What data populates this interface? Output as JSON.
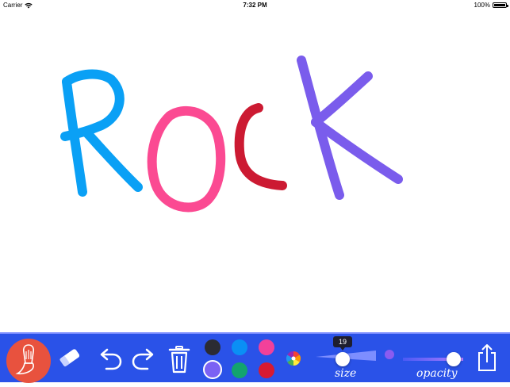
{
  "status_bar": {
    "carrier": "Carrier",
    "time": "7:32 PM",
    "battery": "100%"
  },
  "canvas": {
    "drawing_text": "ROCK",
    "colors": {
      "R": "#0aa0f5",
      "O": "#fb4a92",
      "C": "#cc1a32",
      "K": "#7a5cec"
    }
  },
  "toolbar": {
    "tools": [
      "brush-icon",
      "eraser-icon",
      "undo-icon",
      "redo-icon",
      "trash-icon"
    ],
    "palette": {
      "top_row": [
        "#2b2b33",
        "#0a8ff5",
        "#f2419a"
      ],
      "bottom_row": [
        "#7b62f4",
        "#13a46e",
        "#d81a31"
      ],
      "selected": "#7b62f4"
    },
    "size_slider": {
      "label": "size",
      "value": "19"
    },
    "opacity_slider": {
      "label": "opacity"
    },
    "share_icon": "share-icon"
  }
}
